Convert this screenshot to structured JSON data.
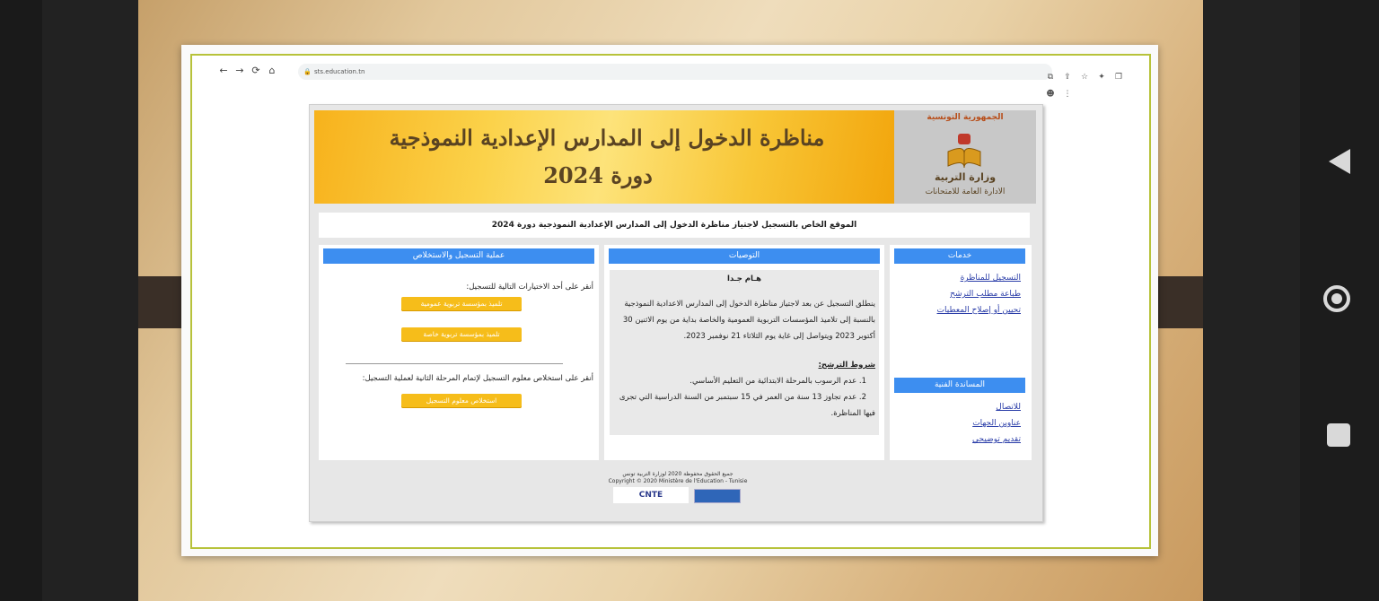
{
  "browser": {
    "url": "sts.education.tn",
    "nav": {
      "back": "←",
      "forward": "→",
      "reload": "⟳",
      "home": "⌂"
    },
    "extensions": [
      "⧉",
      "⇪",
      "☆",
      "✦",
      "❐",
      "☻",
      "⋮"
    ]
  },
  "banner": {
    "title": "مناظرة الدخول إلى المدارس الإعدادية النموذجية",
    "year": "دورة 2024"
  },
  "logo": {
    "top_text": "الجمهورية التونسية",
    "ministry": "وزارة التربية",
    "department": "الادارة العامة للامتحانات"
  },
  "notice": "الموقع الخاص بالتسجيل لاجتياز مناظرة الدخول إلى المدارس الإعدادية النموذجية دورة 2024",
  "services": {
    "header": "خدمات",
    "links": [
      "التسجيل للمناظرة",
      "طباعة مطلب الترشح",
      "تحيين أو إصلاح المعطيات"
    ],
    "support_header": "المساندة الفنية",
    "contact": [
      "للاتصال",
      "عناوين الجهات",
      "تقديم توضيحي"
    ]
  },
  "recommendations": {
    "header": "التوصيات",
    "important": "هـام جـدا",
    "paragraph_lines": [
      "ينطلق التسجيل عن بعد لاجتياز مناظرة الدخول إلى المدارس الاعدادية النموذجية",
      "بالنسبة إلى تلاميذ المؤسسات التربوية العمومية والخاصة بداية من يوم الاثنين 30",
      "أكتوبر 2023 ويتواصل إلى غاية يوم الثلاثاء 21 نوفمبر 2023."
    ],
    "conditions_title": "شروط الترشح:",
    "conditions": [
      "1. عدم الرسوب بالمرحلة الابتدائية من التعليم الأساسي.",
      "2. عدم تجاوز 13 سنة من العمر في 15 سبتمبر من السنة الدراسية التي تجرى",
      "فيها المناظرة."
    ]
  },
  "registration": {
    "header": "عملية التسجيل والاستخلاص",
    "instruction": "أنقر على أحد الاختيارات التالية للتسجيل:",
    "btn_public": "تلميذ بمؤسسة تربوية عمومية",
    "btn_private": "تلميذ بمؤسسة تربوية خاصة",
    "payment_instruction": "أنقر على استخلاص معلوم التسجيل لإتمام المرحلة الثانية لعملية التسجيل:",
    "btn_payment": "استخلاص معلوم التسجيل"
  },
  "footer": {
    "rights_ar": "جميع الحقوق محفوظة 2020 لوزارة التربية تونس",
    "copyright": "Copyright © 2020 Ministère de l'Education - Tunisie",
    "cnte": "CNTE"
  }
}
